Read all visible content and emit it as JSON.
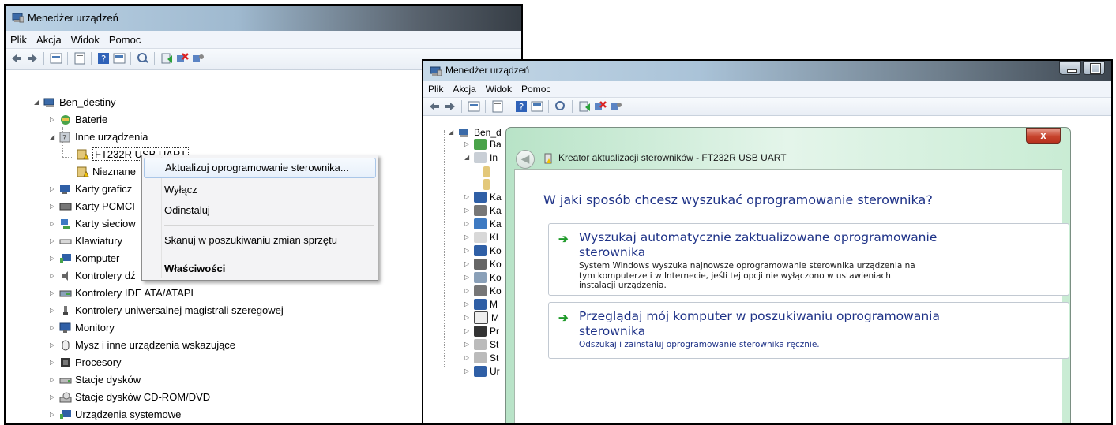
{
  "left_window": {
    "title": "Menedżer urządzeń",
    "menu": [
      "Plik",
      "Akcja",
      "Widok",
      "Pomoc"
    ],
    "tree": {
      "root": "Ben_destiny",
      "items": [
        "Baterie",
        "Inne urządzenia",
        "FT232R USB UART",
        "Nieznane",
        "Karty graficz",
        "Karty PCMCI",
        "Karty sieciow",
        "Klawiatury",
        "Komputer",
        "Kontrolery dź",
        "Kontrolery IDE ATA/ATAPI",
        "Kontrolery uniwersalnej magistrali szeregowej",
        "Monitory",
        "Mysz i inne urządzenia wskazujące",
        "Procesory",
        "Stacje dysków",
        "Stacje dysków CD-ROM/DVD",
        "Urządzenia systemowe"
      ]
    },
    "context_menu": {
      "update": "Aktualizuj oprogramowanie sterownika...",
      "disable": "Wyłącz",
      "uninstall": "Odinstaluj",
      "scan": "Skanuj w poszukiwaniu zmian sprzętu",
      "properties": "Właściwości"
    }
  },
  "right_window": {
    "title": "Menedżer urządzeń",
    "menu": [
      "Plik",
      "Akcja",
      "Widok",
      "Pomoc"
    ],
    "tree": {
      "root": "Ben_d",
      "items": [
        "Ba",
        "In",
        "Ka",
        "Ka",
        "Ka",
        "Kl",
        "Ko",
        "Ko",
        "Ko",
        "Ko",
        "M",
        "M",
        "Pr",
        "St",
        "St",
        "Ur"
      ]
    },
    "wizard": {
      "close": "x",
      "title": "Kreator aktualizacji sterowników - FT232R USB UART",
      "question": "W jaki sposób chcesz wyszukać oprogramowanie sterownika?",
      "option1": {
        "title_line1": "Wyszukaj automatycznie zaktualizowane oprogramowanie",
        "title_line2": "sterownika",
        "desc_line1": "System Windows wyszuka najnowsze oprogramowanie sterownika urządzenia na",
        "desc_line2": "tym komputerze i w Internecie, jeśli tej opcji nie wyłączono w ustawieniach",
        "desc_line3": "instalacji urządzenia."
      },
      "option2": {
        "title_line1": "Przeglądaj mój komputer w poszukiwaniu oprogramowania",
        "title_line2": "sterownika",
        "desc_line1": "Odszukaj i zainstaluj oprogramowanie sterownika ręcznie."
      }
    }
  }
}
